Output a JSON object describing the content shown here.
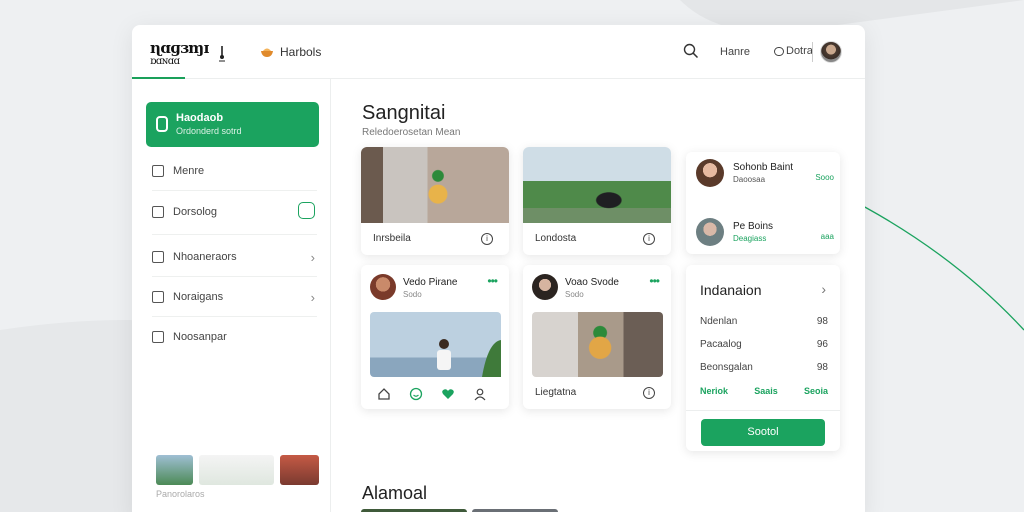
{
  "header": {
    "logo_line1": "ɳɑɡɜɱɪ",
    "logo_line2": "ɒɑɴɑɑ",
    "brand_label": "Harbols",
    "nav_home": "Hanre",
    "nav_extra": "Dotra"
  },
  "sidebar": {
    "active": {
      "title": "Haodaob",
      "subtitle": "Ordonderd sotrd"
    },
    "items": [
      {
        "label": "Menre"
      },
      {
        "label": "Dorsolog"
      },
      {
        "label": "Nhoaneraors"
      },
      {
        "label": "Noraigans"
      },
      {
        "label": "Noosanpar"
      }
    ],
    "footer_label": "Panorolaros"
  },
  "main": {
    "title": "Sangnitai",
    "subtitle": "Reledoerosetan Mean",
    "media_cards": [
      {
        "caption": "Inrsbeila"
      },
      {
        "caption": "Londosta"
      }
    ],
    "posts": [
      {
        "name": "Vedo Pirane",
        "sub": "Sodo"
      },
      {
        "name": "Voao Svode",
        "sub": "Sodo",
        "caption": "Liegtatna"
      }
    ],
    "section2_title": "Alamoal"
  },
  "people": [
    {
      "name": "Sohonb Baint",
      "sub": "Daoosaa",
      "action": "Sooo"
    },
    {
      "name": "Pe Boins",
      "sub": "Deagiass",
      "action": "aaa"
    }
  ],
  "info_card": {
    "title": "Indanaion",
    "rows": [
      {
        "label": "Ndenlan",
        "value": "98"
      },
      {
        "label": "Pacaalog",
        "value": "96"
      },
      {
        "label": "Beonsgalan",
        "value": "98"
      }
    ],
    "links": [
      "Neriok",
      "Saais",
      "Seoia"
    ],
    "button_label": "Sootol"
  },
  "colors": {
    "accent": "#1ba35f",
    "background": "#eef0f2"
  }
}
